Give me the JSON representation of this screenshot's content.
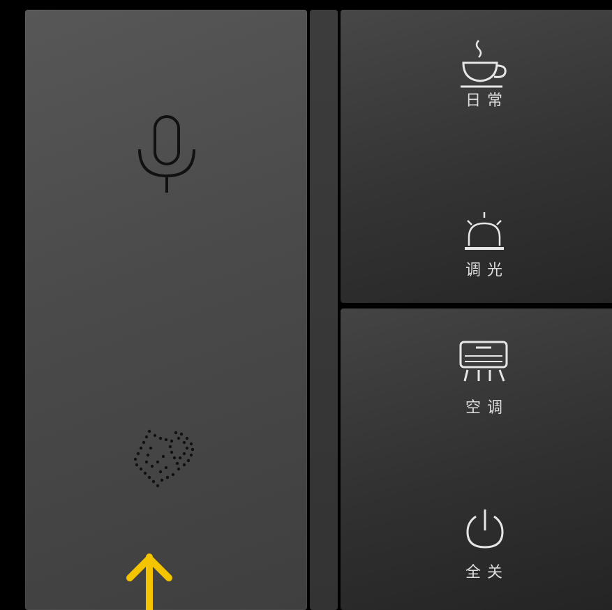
{
  "scenes": [
    {
      "label": "日常",
      "icon": "coffee-cup-icon"
    },
    {
      "label": "调光",
      "icon": "lamp-icon"
    }
  ],
  "controls": [
    {
      "label": "空调",
      "icon": "air-conditioner-icon"
    },
    {
      "label": "全关",
      "icon": "power-icon"
    }
  ],
  "left_panel": {
    "top_icon": "microphone-icon",
    "bottom_icon": "dotted-speaker-icon",
    "indicator_icon": "up-arrow-icon",
    "indicator_color": "#f5c400"
  }
}
